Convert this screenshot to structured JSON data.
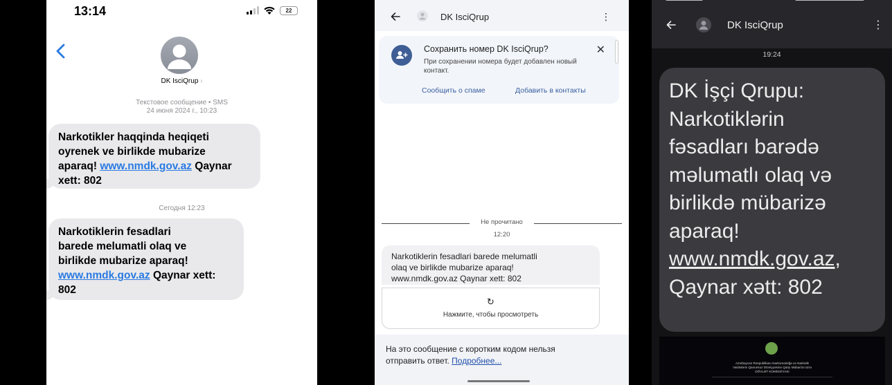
{
  "ios": {
    "status_time": "13:14",
    "battery": "22",
    "contact_name": "DK IsciQrup",
    "contact_chevron": "›",
    "meta_line1": "Текстовое сообщение • SMS",
    "meta_line2": "24 июня 2024 г., 10:23",
    "msg1": {
      "line1": "Narkotikler haqqinda heqiqeti",
      "line2": "oyrenek ve birlikde mubarize",
      "line3_pre": "aparaq! ",
      "link": "www.nmdk.gov.az",
      "line3_post": " Qaynar",
      "line4": "xett: 802"
    },
    "meta_today": "Сегодня 12:23",
    "msg2": {
      "line1": "Narkotiklerin fesadlari",
      "line2": "barede melumatli olaq ve",
      "line3": "birlikde mubarize aparaq!",
      "link": "www.nmdk.gov.az",
      "line4_post": " Qaynar xett:",
      "line5": "802"
    }
  },
  "android_light": {
    "contact_name": "DK IsciQrup",
    "card": {
      "title": "Сохранить номер DK IsciQrup?",
      "desc": "При сохранении номера будет добавлен новый контакт.",
      "action_spam": "Сообщить о спаме",
      "action_add": "Добавить в контакты"
    },
    "unread_label": "Не прочитано",
    "time": "12:20",
    "msg": {
      "line1": "Narkotiklerin fesadlari barede melumatli",
      "line2": "olaq ve birlikde mubarize aparaq!",
      "line3": "www.nmdk.gov.az Qaynar xett: 802"
    },
    "view_icon": "↻",
    "view_label": "Нажмите, чтобы просмотреть",
    "bottom_text": "На это сообщение с коротким кодом нельзя отправить ответ. ",
    "bottom_link": "Подробнее..."
  },
  "android_dark": {
    "contact_name": "DK IsciQrup",
    "time": "19:24",
    "msg": {
      "line1": "DK İşçi Qrupu:",
      "line2": "Narkotiklərin",
      "line3": "fəsadları barədə",
      "line4": "məlumatlı olaq və",
      "line5": "birlikdə mübarizə",
      "line6": "aparaq!",
      "link": "www.nmdk.gov.az",
      "line7_suffix": ",",
      "line8": "Qaynar xətt: 802"
    },
    "preview": {
      "line1": "Azərbaycan Respublikası Narkomanlığa və Narkotik",
      "line2": "Vasitələrin Qanunsuz Dövriyyəsinə Qarşı Mübarizə üzrə",
      "line3": "DÖVLƏT KOMİSSİYASI"
    }
  },
  "colors": {
    "ios_link": "#2a7ae2",
    "ios_bubble": "#e9e9eb",
    "android_accent": "#3a5fa0",
    "dark_bubble": "#3a3a3f"
  },
  "icons": [
    "back-chevron-icon",
    "signal-icon",
    "wifi-icon",
    "battery-icon",
    "contact-avatar-icon",
    "add-contact-icon",
    "close-icon",
    "refresh-icon",
    "more-vert-icon",
    "back-arrow-icon"
  ]
}
